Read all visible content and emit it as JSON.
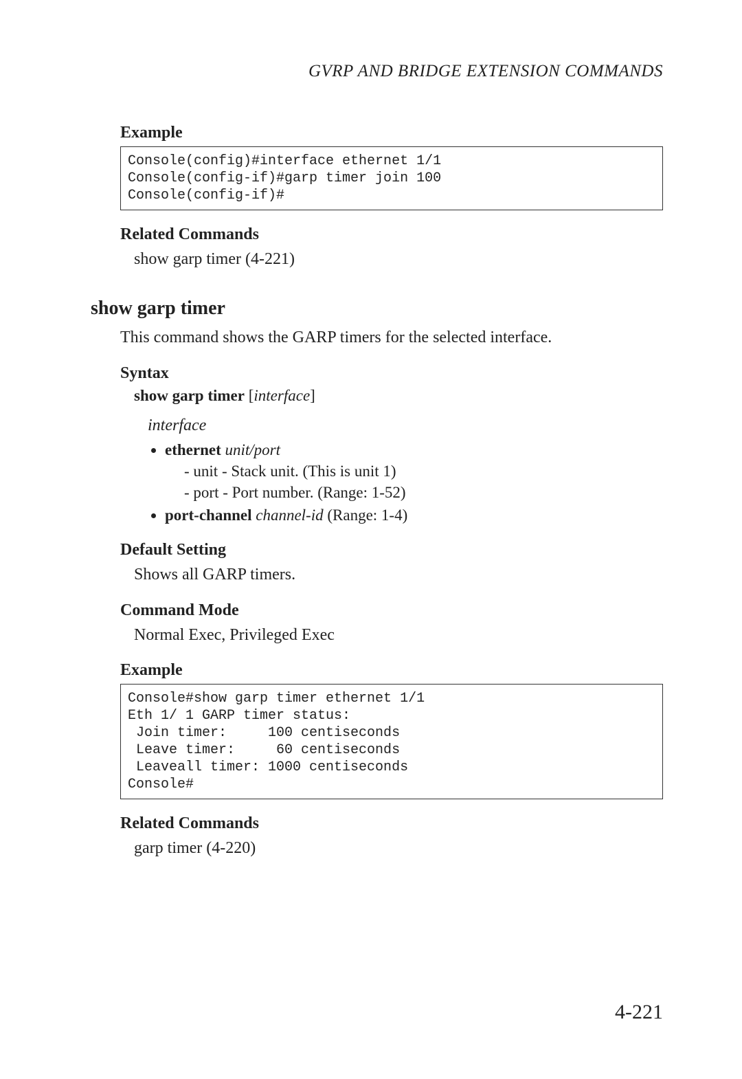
{
  "runningHead": {
    "prefix": "GVRP ",
    "smallcaps1": "and",
    "mid": " B",
    "smallcaps2": "ridge",
    "mid2": " E",
    "smallcaps3": "xtension",
    "mid3": " C",
    "smallcaps4": "ommands",
    "full": "GVRP AND BRIDGE EXTENSION COMMANDS"
  },
  "example1": {
    "heading": "Example",
    "code": "Console(config)#interface ethernet 1/1\nConsole(config-if)#garp timer join 100\nConsole(config-if)#"
  },
  "related1": {
    "heading": "Related Commands",
    "text": "show garp timer (4-221)"
  },
  "command": {
    "title": "show garp timer",
    "description": "This command shows the GARP timers for the selected interface."
  },
  "syntax": {
    "heading": "Syntax",
    "cmd_bold": "show garp timer",
    "arg_open": " [",
    "arg_italic": "interface",
    "arg_close": "]",
    "interface_label": "interface",
    "eth_bold": "ethernet",
    "eth_arg": " unit/port",
    "unit_line": "-  unit - Stack unit. (This is unit 1)",
    "port_line": "-  port - Port number. (Range: 1-52)",
    "pc_bold": "port-channel",
    "pc_arg_italic": " channel-id",
    "pc_range": " (Range: 1-4)"
  },
  "default": {
    "heading": "Default Setting",
    "text": "Shows all GARP timers."
  },
  "mode": {
    "heading": "Command Mode",
    "text": "Normal Exec, Privileged Exec"
  },
  "example2": {
    "heading": "Example",
    "code": "Console#show garp timer ethernet 1/1\nEth 1/ 1 GARP timer status:\n Join timer:     100 centiseconds\n Leave timer:     60 centiseconds\n Leaveall timer: 1000 centiseconds\nConsole#"
  },
  "related2": {
    "heading": "Related Commands",
    "text": "garp timer (4-220)"
  },
  "pageNumber": "4-221"
}
